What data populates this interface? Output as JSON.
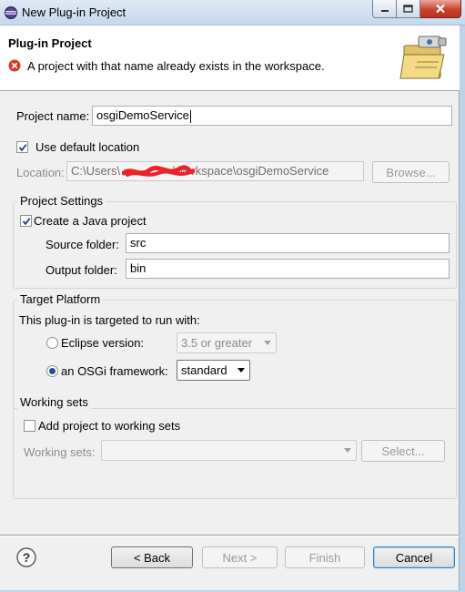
{
  "window": {
    "title": "New Plug-in Project"
  },
  "header": {
    "title": "Plug-in Project",
    "error_message": "A project with that name already exists in the workspace."
  },
  "project_name": {
    "label": "Project name:",
    "value": "osgiDemoService"
  },
  "location": {
    "use_default_label": "Use default location",
    "use_default_checked": true,
    "label": "Location:",
    "value_start": "C:\\Users\\",
    "value_end": "\\workspace\\osgiDemoService",
    "browse_label": "Browse..."
  },
  "project_settings": {
    "group_label": "Project Settings",
    "create_java_label": "Create a Java project",
    "create_java_checked": true,
    "source_folder_label": "Source folder:",
    "source_folder_value": "src",
    "output_folder_label": "Output folder:",
    "output_folder_value": "bin"
  },
  "target_platform": {
    "group_label": "Target Platform",
    "description": "This plug-in is targeted to run with:",
    "eclipse_label": "Eclipse version:",
    "eclipse_selected": false,
    "eclipse_version": "3.5 or greater",
    "osgi_label": "an OSGi framework:",
    "osgi_selected": true,
    "osgi_framework": "standard"
  },
  "working_sets": {
    "group_label": "Working sets",
    "add_label": "Add project to working sets",
    "add_checked": false,
    "sets_label": "Working sets:",
    "sets_value": "",
    "select_label": "Select..."
  },
  "footer": {
    "back_label": "< Back",
    "next_label": "Next >",
    "finish_label": "Finish",
    "cancel_label": "Cancel"
  },
  "colors": {
    "error_red": "#d23b2c",
    "redaction_red": "#e8232a"
  }
}
